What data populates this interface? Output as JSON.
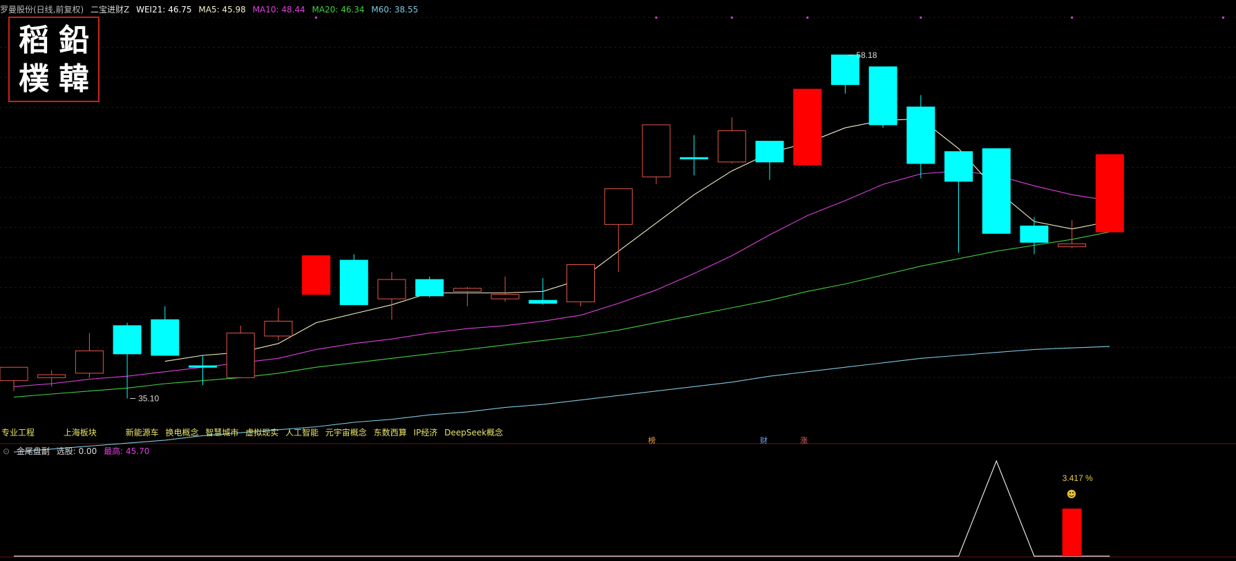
{
  "header": {
    "stock_label": "罗曼股份(日线,前复权)",
    "indicator_name": "二宝进财Z",
    "wei21": "WEI21: 46.75",
    "ma5": "MA5: 45.98",
    "ma10": "MA10: 48.44",
    "ma20": "MA20: 46.34",
    "ma60": "M60: 38.55"
  },
  "seal_chars": [
    "鉛",
    "稻",
    "韓",
    "樸"
  ],
  "annotations": {
    "high": "58.18",
    "low": "35.10"
  },
  "concept_tags": [
    "专业工程",
    "上海板块",
    "新能源车",
    "换电概念",
    "智慧城市",
    "虚拟现实",
    "人工智能",
    "元宇宙概念",
    "东数西算",
    "IP经济",
    "DeepSeek概念"
  ],
  "event_badges": [
    "榜",
    "财",
    "涨"
  ],
  "sub_panel": {
    "title": "金尾盘副",
    "select": "选股: 0.00",
    "high_label": "最高: 45.70",
    "percent": "3.417 %"
  },
  "colors": {
    "up": "#ff0000",
    "up_hollow": "#e8584a",
    "down": "#00ffff",
    "ma5": "#f4f0c8",
    "ma10": "#e040e0",
    "ma20": "#40d040",
    "ma60": "#7ec8e0"
  },
  "chart_data": {
    "type": "candlestick",
    "y_range": [
      33.5,
      60.5
    ],
    "candles": [
      {
        "o": 36.3,
        "h": 37.1,
        "l": 35.6,
        "c": 37.2,
        "fill": "hollow"
      },
      {
        "o": 36.5,
        "h": 37.0,
        "l": 35.9,
        "c": 36.7,
        "fill": "hollow"
      },
      {
        "o": 36.8,
        "h": 39.5,
        "l": 36.5,
        "c": 38.3,
        "fill": "hollow"
      },
      {
        "o": 40.0,
        "h": 40.2,
        "l": 35.1,
        "c": 38.1,
        "fill": "cyan"
      },
      {
        "o": 40.4,
        "h": 41.3,
        "l": 38.0,
        "c": 38.0,
        "fill": "cyan"
      },
      {
        "o": 37.3,
        "h": 38.0,
        "l": 36.0,
        "c": 37.2,
        "fill": "cyan"
      },
      {
        "o": 36.5,
        "h": 40.0,
        "l": 36.5,
        "c": 39.5,
        "fill": "hollow"
      },
      {
        "o": 39.3,
        "h": 41.2,
        "l": 39.0,
        "c": 40.3,
        "fill": "hollow"
      },
      {
        "o": 42.1,
        "h": 44.7,
        "l": 42.1,
        "c": 44.7,
        "fill": "red"
      },
      {
        "o": 44.4,
        "h": 44.8,
        "l": 41.4,
        "c": 41.4,
        "fill": "cyan"
      },
      {
        "o": 41.8,
        "h": 43.6,
        "l": 40.4,
        "c": 43.1,
        "fill": "hollow"
      },
      {
        "o": 43.1,
        "h": 43.3,
        "l": 41.9,
        "c": 42.0,
        "fill": "cyan"
      },
      {
        "o": 42.3,
        "h": 42.6,
        "l": 41.3,
        "c": 42.5,
        "fill": "hollow"
      },
      {
        "o": 41.8,
        "h": 43.3,
        "l": 41.6,
        "c": 42.1,
        "fill": "hollow"
      },
      {
        "o": 41.7,
        "h": 43.2,
        "l": 41.4,
        "c": 41.5,
        "fill": "cyan"
      },
      {
        "o": 41.6,
        "h": 44.0,
        "l": 41.3,
        "c": 44.1,
        "fill": "hollow"
      },
      {
        "o": 46.8,
        "h": 48.2,
        "l": 43.6,
        "c": 49.2,
        "fill": "hollow"
      },
      {
        "o": 50.0,
        "h": 52.7,
        "l": 49.5,
        "c": 53.5,
        "fill": "hollow"
      },
      {
        "o": 51.3,
        "h": 52.8,
        "l": 50.1,
        "c": 51.3,
        "fill": "cyan"
      },
      {
        "o": 51.0,
        "h": 54.0,
        "l": 50.9,
        "c": 53.1,
        "fill": "hollow"
      },
      {
        "o": 52.4,
        "h": 52.4,
        "l": 49.8,
        "c": 51.0,
        "fill": "cyan"
      },
      {
        "o": 50.8,
        "h": 55.9,
        "l": 50.8,
        "c": 55.9,
        "fill": "red"
      },
      {
        "o": 58.2,
        "h": 58.2,
        "l": 55.6,
        "c": 56.2,
        "fill": "cyan"
      },
      {
        "o": 57.4,
        "h": 57.4,
        "l": 53.3,
        "c": 53.5,
        "fill": "cyan"
      },
      {
        "o": 54.7,
        "h": 55.5,
        "l": 49.9,
        "c": 50.9,
        "fill": "cyan"
      },
      {
        "o": 51.7,
        "h": 51.7,
        "l": 44.9,
        "c": 49.7,
        "fill": "cyan"
      },
      {
        "o": 51.9,
        "h": 51.9,
        "l": 46.3,
        "c": 46.2,
        "fill": "cyan"
      },
      {
        "o": 46.7,
        "h": 47.3,
        "l": 44.8,
        "c": 45.6,
        "fill": "cyan"
      },
      {
        "o": 45.5,
        "h": 47.1,
        "l": 45.2,
        "c": 45.3,
        "fill": "hollow"
      },
      {
        "o": 46.3,
        "h": 51.5,
        "l": 46.3,
        "c": 51.5,
        "fill": "red"
      }
    ],
    "ma5": [
      null,
      null,
      null,
      null,
      37.6,
      38.0,
      38.2,
      38.8,
      40.2,
      40.8,
      41.4,
      42.2,
      42.2,
      42.2,
      42.3,
      43.1,
      45.0,
      46.9,
      48.8,
      50.4,
      51.6,
      52.3,
      53.3,
      53.8,
      53.9,
      51.9,
      49.1,
      47.0,
      46.5,
      47.0
    ],
    "ma10": [
      35.9,
      36.1,
      36.4,
      36.6,
      36.9,
      37.2,
      37.5,
      37.8,
      38.4,
      38.8,
      39.1,
      39.5,
      39.8,
      40.0,
      40.3,
      40.7,
      41.5,
      42.4,
      43.5,
      44.7,
      46.1,
      47.4,
      48.4,
      49.5,
      50.2,
      50.4,
      50.1,
      49.4,
      48.8,
      48.4
    ],
    "ma20": [
      35.2,
      35.4,
      35.6,
      35.8,
      36.1,
      36.3,
      36.5,
      36.8,
      37.2,
      37.5,
      37.8,
      38.1,
      38.4,
      38.7,
      39.0,
      39.3,
      39.7,
      40.2,
      40.7,
      41.2,
      41.7,
      42.3,
      42.8,
      43.4,
      44.0,
      44.5,
      45.0,
      45.4,
      45.8,
      46.3
    ],
    "ma60": [
      31.5,
      31.7,
      31.9,
      32.1,
      32.3,
      32.6,
      32.8,
      33.0,
      33.2,
      33.5,
      33.7,
      34.0,
      34.2,
      34.5,
      34.7,
      35.0,
      35.3,
      35.6,
      35.9,
      36.2,
      36.6,
      36.9,
      37.2,
      37.5,
      37.8,
      38.0,
      38.2,
      38.4,
      38.5,
      38.6
    ],
    "dots_at": [
      8,
      17,
      19,
      21,
      24,
      28,
      32
    ],
    "sub_line": [
      0,
      0,
      0,
      0,
      0,
      0,
      0,
      0,
      0,
      0,
      0,
      0,
      0,
      0,
      0,
      0,
      0,
      0,
      0,
      0,
      0,
      0,
      0,
      0,
      0,
      0,
      100,
      0,
      0,
      0
    ],
    "sub_bar": {
      "index": 28,
      "value": 50
    }
  }
}
